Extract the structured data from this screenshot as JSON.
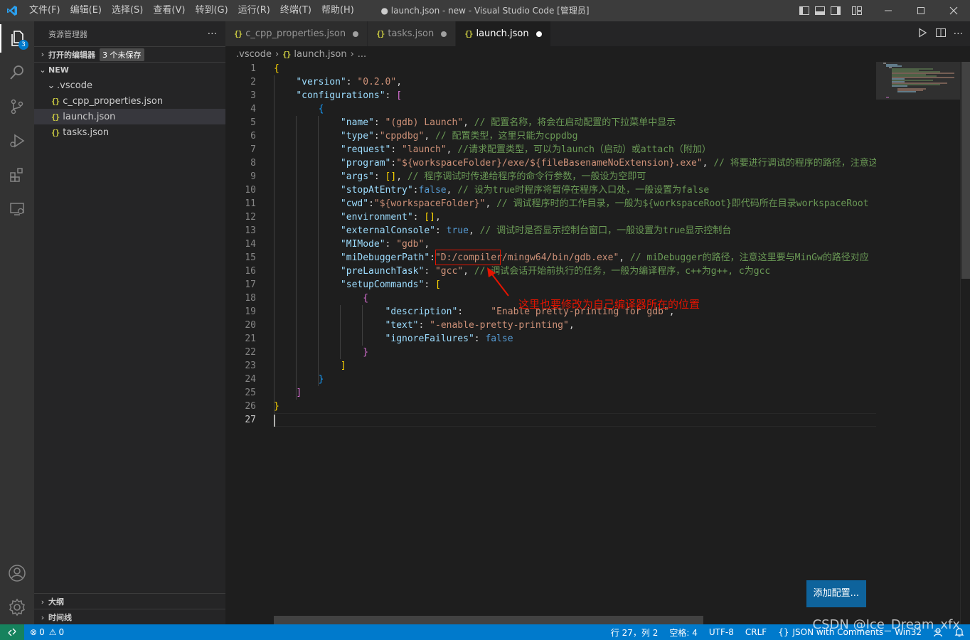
{
  "window": {
    "title": "● launch.json - new - Visual Studio Code [管理员]",
    "menu": [
      "文件(F)",
      "编辑(E)",
      "选择(S)",
      "查看(V)",
      "转到(G)",
      "运行(R)",
      "终端(T)",
      "帮助(H)"
    ]
  },
  "activity_bar": {
    "explorer_badge": "3",
    "icons": [
      "files-icon",
      "search-icon",
      "source-control-icon",
      "run-debug-icon",
      "extensions-icon",
      "remote-explorer-icon",
      "account-icon",
      "settings-gear-icon"
    ]
  },
  "sidebar": {
    "title": "资源管理器",
    "more": "···",
    "open_editors_label": "打开的编辑器",
    "unsaved_badge": "3 个未保存",
    "folder_label": "NEW",
    "subfolder": ".vscode",
    "files": [
      "c_cpp_properties.json",
      "launch.json",
      "tasks.json"
    ],
    "selected_file": "launch.json",
    "file_icon_glyph": "{}",
    "outline_label": "大纲",
    "timeline_label": "时间线"
  },
  "tabs": [
    {
      "label": "c_cpp_properties.json",
      "active": false
    },
    {
      "label": "tasks.json",
      "active": false
    },
    {
      "label": "launch.json",
      "active": true
    }
  ],
  "breadcrumb": {
    "folder": ".vscode",
    "file": "launch.json",
    "more": "..."
  },
  "editor": {
    "line_numbers": [
      "1",
      "2",
      "3",
      "4",
      "5",
      "6",
      "7",
      "8",
      "9",
      "10",
      "11",
      "12",
      "13",
      "14",
      "15",
      "16",
      "17",
      "18",
      "19",
      "20",
      "21",
      "22",
      "23",
      "24",
      "25",
      "26",
      "27"
    ],
    "current_line": "27",
    "lines": [
      "{",
      "    \"version\": \"0.2.0\",",
      "    \"configurations\": [",
      "        {",
      "            \"name\": \"(gdb) Launch\", // 配置名称，将会在启动配置的下拉菜单中显示",
      "            \"type\":\"cppdbg\", // 配置类型，这里只能为cppdbg",
      "            \"request\": \"launch\", //请求配置类型，可以为launch（启动）或attach（附加）",
      "            \"program\":\"${workspaceFolder}/exe/${fileBasenameNoExtension}.exe\", // 将要进行调试的程序的路径，注意这",
      "            \"args\": [], // 程序调试时传递给程序的命令行参数，一般设为空即可",
      "            \"stopAtEntry\":false, // 设为true时程序将暂停在程序入口处，一般设置为false",
      "            \"cwd\":\"${workspaceFolder}\", // 调试程序时的工作目录，一般为${workspaceRoot}即代码所在目录workspaceRoot",
      "            \"environment\": [],",
      "            \"externalConsole\": true, // 调试时是否显示控制台窗口，一般设置为true显示控制台",
      "            \"MIMode\": \"gdb\",",
      "            \"miDebuggerPath\":\"D:/compiler/mingw64/bin/gdb.exe\", // miDebugger的路径，注意这里要与MinGw的路径对应",
      "            \"preLaunchTask\": \"gcc\", // 调试会话开始前执行的任务，一般为编译程序，c++为g++, c为gcc",
      "            \"setupCommands\": [",
      "                {",
      "                    \"description\":     \"Enable pretty-printing for gdb\",",
      "                    \"text\": \"-enable-pretty-printing\",",
      "                    \"ignoreFailures\": false",
      "                }",
      "            ]",
      "        }",
      "    ]",
      "}",
      ""
    ],
    "annotation": "这里也要修改为自己编译器所在的位置",
    "add_config_button": "添加配置..."
  },
  "status_bar": {
    "errors": "0",
    "warnings": "0",
    "position": "行 27，列 2",
    "indent": "空格: 4",
    "encoding": "UTF-8",
    "eol": "CRLF",
    "language_icon": "{}",
    "language": "JSON with Comments",
    "platform": "Win32"
  },
  "watermark": "CSDN @Ice_Dream_xfx",
  "colors": {
    "accent": "#007acc",
    "annotation": "#e51400",
    "json_icon": "#cbcb41"
  }
}
